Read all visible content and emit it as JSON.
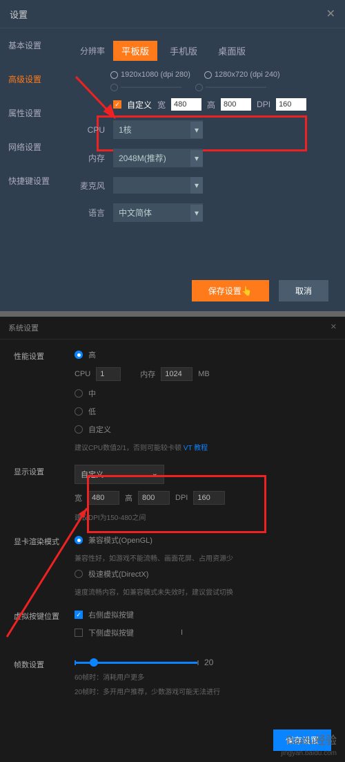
{
  "p1": {
    "title": "设置",
    "tabs": [
      "基本设置",
      "高级设置",
      "属性设置",
      "网络设置",
      "快捷键设置"
    ],
    "resolution_label": "分辨率",
    "res_tabs": [
      "平板版",
      "手机版",
      "桌面版"
    ],
    "res_radios": [
      "1920x1080 (dpi 280)",
      "1280x720 (dpi 240)"
    ],
    "custom_check_label": "自定义",
    "custom_w_lbl": "宽",
    "custom_w": "480",
    "custom_h_lbl": "高",
    "custom_h": "800",
    "custom_dpi_lbl": "DPI",
    "custom_dpi": "160",
    "cpu_label": "CPU",
    "cpu_value": "1核",
    "mem_label": "内存",
    "mem_value": "2048M(推荐)",
    "mic_label": "麦克风",
    "mic_value": "",
    "lang_label": "语言",
    "lang_value": "中文简体",
    "save_btn": "保存设置",
    "cancel_btn": "取消"
  },
  "p2": {
    "title": "系统设置",
    "perf_label": "性能设置",
    "perf_radio_high": "高",
    "cpu_label": "CPU",
    "cpu_value": "1",
    "mem_label": "内存",
    "mem_value": "1024",
    "mem_unit": "MB",
    "perf_radio_mid": "中",
    "perf_radio_low": "低",
    "perf_radio_custom": "自定义",
    "perf_hint": "建议CPU数值2/1，否则可能较卡顿",
    "perf_link": "VT 教程",
    "disp_label": "显示设置",
    "disp_select": "自定义",
    "disp_w_lbl": "宽",
    "disp_w": "480",
    "disp_h_lbl": "高",
    "disp_h": "800",
    "disp_dpi_lbl": "DPI",
    "disp_dpi": "160",
    "disp_hint": "建议DPI为150-480之间",
    "render_label": "显卡渲染模式",
    "render_opt1": "兼容模式(OpenGL)",
    "render_hint1": "兼容性好，如游戏不能流畅、画面花屏、占用资源少",
    "render_opt2": "极速模式(DirectX)",
    "render_hint2": "速度流畅内容，如兼容模式未失效时，建议尝试切换",
    "vkey_label": "虚拟按键位置",
    "vkey_check1": "右侧虚拟按键",
    "vkey_check2": "下侧虚拟按键",
    "fps_label": "帧数设置",
    "fps_max": "20",
    "fps_hint1": "60帧时：消耗用户更多",
    "fps_hint2": "20帧时：多开用户推荐，少数游戏可能无法进行",
    "save_btn": "保存设置"
  },
  "watermark": {
    "logo": "Baidu经验",
    "url": "jingyan.baidu.com"
  }
}
